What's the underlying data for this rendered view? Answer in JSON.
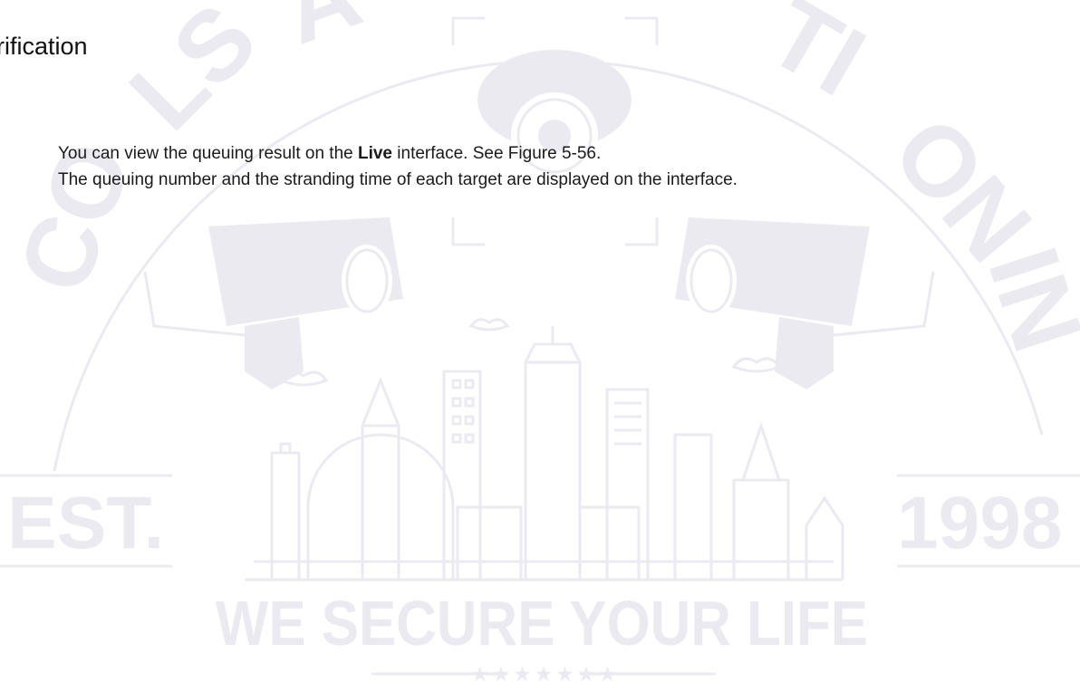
{
  "section": {
    "heading": "rification"
  },
  "paragraphs": {
    "p1_before": "You can view the queuing result on the ",
    "p1_bold": "Live",
    "p1_after": " interface. See Figure 5-56.",
    "p2": "The queuing number and the stranding time of each target are displayed on the interface."
  },
  "watermark": {
    "ring_text": "COLSAN SECURITY SOLUTION, INC",
    "left_text": "EST.",
    "right_text": "1998",
    "slogan": "WE SECURE YOUR LIFE",
    "stars": "★ ★ ★ ★ ★ ★ ★",
    "color": "#eceaf1"
  }
}
